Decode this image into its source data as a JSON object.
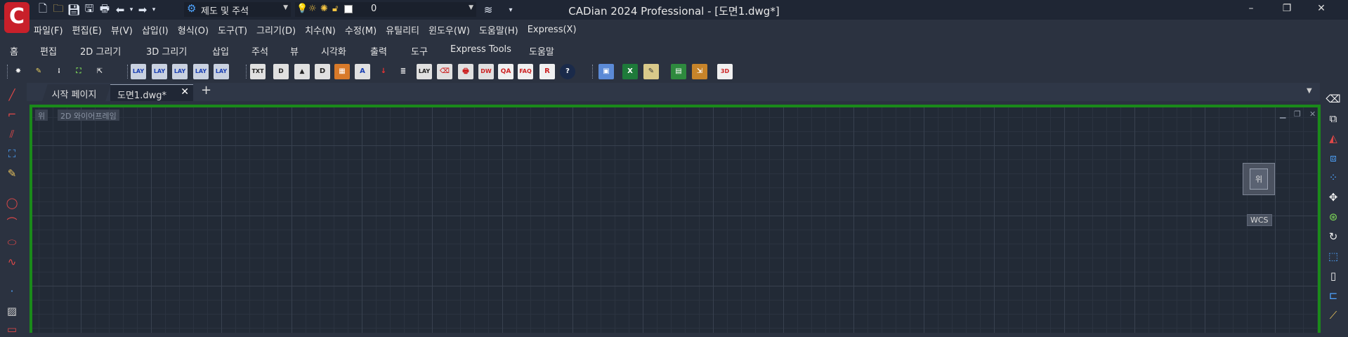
{
  "window": {
    "title": "CADian 2024 Professional - [도면1.dwg*]",
    "controls": {
      "minimize": "–",
      "restore": "❐",
      "close": "✕"
    }
  },
  "quick_access": {
    "workspace": "제도 및 주석",
    "layer": "0"
  },
  "menu": [
    "파일(F)",
    "편집(E)",
    "뷰(V)",
    "삽입(I)",
    "형식(O)",
    "도구(T)",
    "그리기(D)",
    "치수(N)",
    "수정(M)",
    "유틸리티",
    "윈도우(W)",
    "도움말(H)",
    "Express(X)"
  ],
  "ribbon_tabs": [
    "홈",
    "편집",
    "2D 그리기",
    "3D 그리기",
    "삽입",
    "주석",
    "뷰",
    "시각화",
    "출력",
    "도구",
    "Express Tools",
    "도움말"
  ],
  "doc_tabs": {
    "start": "시작 페이지",
    "active": "도면1.dwg*",
    "add": "+"
  },
  "viewport": {
    "view_label": "위",
    "style_label": "2D 와이어프레임",
    "viewcube_face": "위",
    "ucs_label": "WCS"
  },
  "colors": {
    "accent_green": "#1a8a1a",
    "brand_red": "#c8202a",
    "background": "#2b3240"
  }
}
